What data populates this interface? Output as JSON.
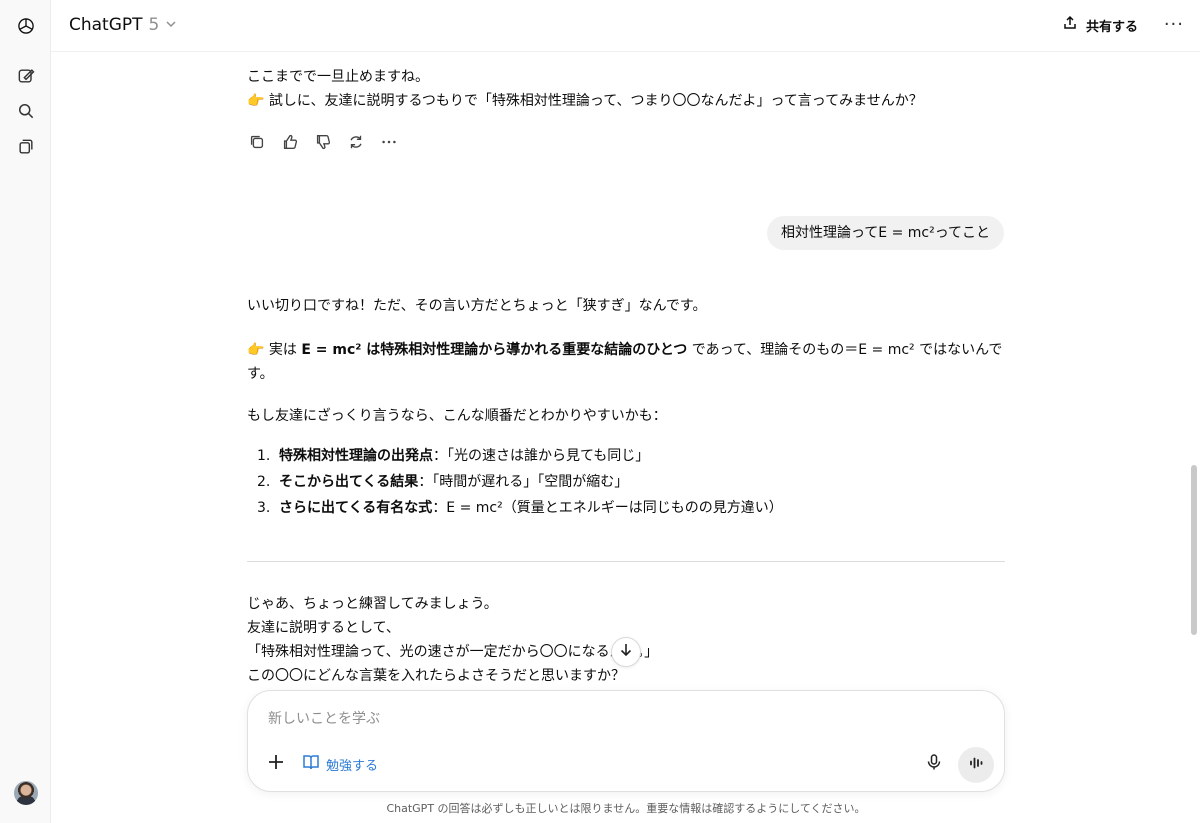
{
  "header": {
    "model_name": "ChatGPT",
    "model_version": "5",
    "share_label": "共有する",
    "more_label": "···"
  },
  "sidebar": {
    "icons": [
      "openai-logo-icon",
      "new-chat-icon",
      "search-icon",
      "library-icon"
    ]
  },
  "thread": {
    "prev_assistant": {
      "line1": "ここまでで一旦止めますね。",
      "line2_emoji": "👉",
      "line2": "試しに、友達に説明するつもりで「特殊相対性理論って、つまり〇〇なんだよ」って言ってみませんか？"
    },
    "user_message": "相対性理論ってE = mc²ってこと",
    "reply": {
      "intro": "いい切り口ですね！ただ、その言い方だとちょっと「狭すぎ」なんです。",
      "point_emoji": "👉",
      "point_pre": "実は ",
      "point_bold": "E = mc² は特殊相対性理論から導かれる重要な結論のひとつ",
      "point_post": " であって、理論そのもの＝E = mc² ではないんで",
      "point_wrap": "す。",
      "lead": "もし友達にざっくり言うなら、こんな順番だとわかりやすいかも：",
      "steps": [
        {
          "num": "1.",
          "bold": "特殊相対性理論の出発点",
          "text": "：「光の速さは誰から見ても同じ」"
        },
        {
          "num": "2.",
          "bold": "そこから出てくる結果",
          "text": "：「時間が遅れる」「空間が縮む」"
        },
        {
          "num": "3.",
          "bold": "さらに出てくる有名な式",
          "text": "：E = mc²（質量とエネルギーは同じものの見方違い）"
        }
      ],
      "practice_1": "じゃあ、ちょっと練習してみましょう。",
      "practice_2": "友達に説明するとして、",
      "practice_3": "「特殊相対性理論って、光の速さが一定だから〇〇になるんだ。」",
      "practice_4": "この〇〇にどんな言葉を入れたらよさそうだと思いますか？"
    }
  },
  "composer": {
    "placeholder": "新しいことを学ぶ",
    "study_label": "勉強する"
  },
  "footnote": "ChatGPT の回答は必ずしも正しいとは限りません。重要な情報は確認するようにしてください。",
  "colors": {
    "accent": "#2b7bd6",
    "bubble": "#f1f1f1"
  }
}
